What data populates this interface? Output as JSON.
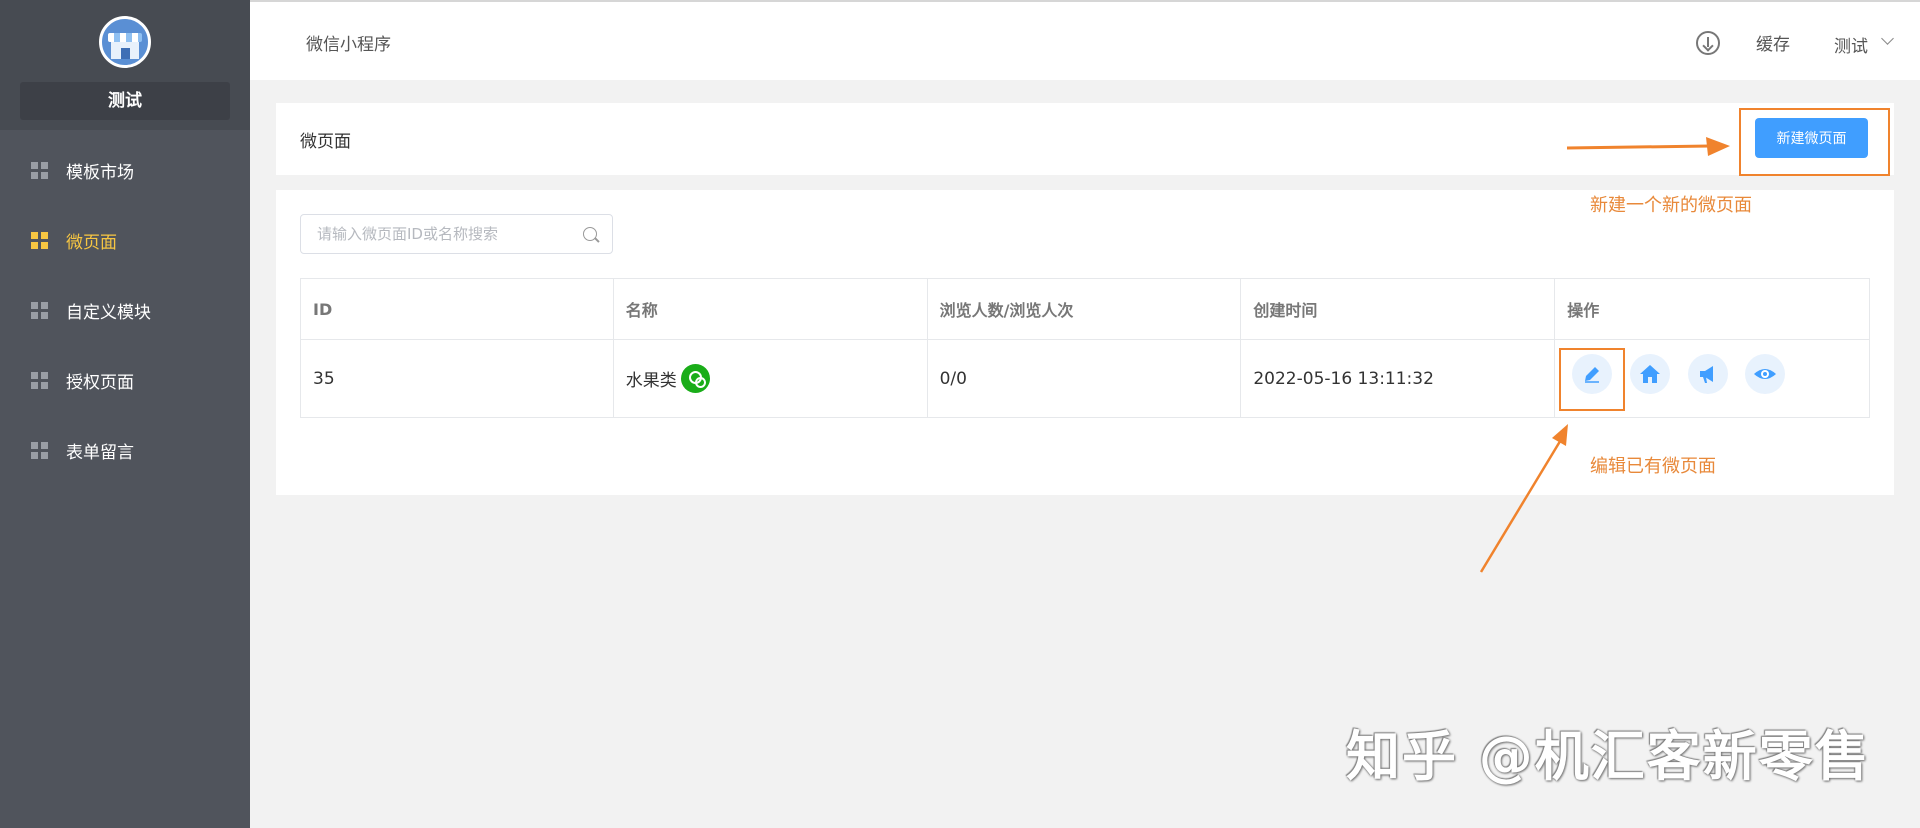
{
  "sidebar": {
    "shop_name": "测试",
    "items": [
      {
        "label": "模板市场",
        "active": false
      },
      {
        "label": "微页面",
        "active": true
      },
      {
        "label": "自定义模块",
        "active": false
      },
      {
        "label": "授权页面",
        "active": false
      },
      {
        "label": "表单留言",
        "active": false
      }
    ]
  },
  "header": {
    "breadcrumb": "微信小程序",
    "cache_label": "缓存",
    "user_label": "测试"
  },
  "page": {
    "title": "微页面",
    "new_button_label": "新建微页面"
  },
  "search": {
    "placeholder": "请输入微页面ID或名称搜索",
    "value": ""
  },
  "table": {
    "headers": [
      "ID",
      "名称",
      "浏览人数/浏览人次",
      "创建时间",
      "操作"
    ],
    "rows": [
      {
        "id": "35",
        "name": "水果类",
        "views": "0/0",
        "created": "2022-05-16 13:11:32"
      }
    ],
    "actions": [
      "edit-icon",
      "home-icon",
      "megaphone-icon",
      "eye-icon"
    ]
  },
  "annotations": {
    "new_page_note": "新建一个新的微页面",
    "edit_page_note": "编辑已有微页面"
  },
  "watermark": "知乎 @机汇客新零售",
  "colors": {
    "sidebar_bg": "#50545c",
    "active": "#f7c642",
    "primary": "#409eff",
    "annotation": "#f0832d",
    "mini_program_green": "#1aad19"
  }
}
